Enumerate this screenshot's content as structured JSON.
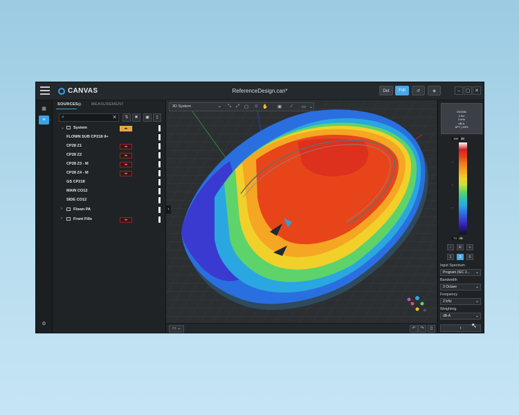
{
  "app": {
    "logo_text": "CANVAS",
    "document_title": "ReferenceDesign.can*",
    "buttons": {
      "det": "Det",
      "full": "Full"
    }
  },
  "sources_panel": {
    "tab_sources": "SOURCES",
    "tab_measurement": "MEASUREMENT",
    "search_placeholder": "",
    "tree": [
      {
        "label": "System",
        "expandable": true,
        "expanded": true
      },
      {
        "label": "FLOWN SUB CP218 II+"
      },
      {
        "label": "CP28 Z1"
      },
      {
        "label": "CP28 Z2"
      },
      {
        "label": "CP28 Z3 - M"
      },
      {
        "label": "CP28 Z4 - M"
      },
      {
        "label": "GS CP218"
      },
      {
        "label": "MAIN CO12"
      },
      {
        "label": "SIDE CO12"
      },
      {
        "label": "Flown PA",
        "expandable": true,
        "expanded": false
      },
      {
        "label": "Front Fills",
        "expandable": true,
        "expanded": false
      }
    ]
  },
  "viewport": {
    "view_mode": "3D System"
  },
  "right_panel": {
    "legend": [
      "ISO266",
      "2.0m",
      "2 kHz",
      "dB-A",
      "SPT | 63%"
    ],
    "scale_max": "104",
    "scale_min": "74",
    "scale_unit": "dB",
    "scale_colors": [
      "#ffffff",
      "#d42020",
      "#e8441a",
      "#f07a1e",
      "#f5a623",
      "#f2d02a",
      "#c8e23a",
      "#5ed36a",
      "#2ec2b0",
      "#2aa6e0",
      "#2a6fe0",
      "#3a3ad0",
      "#2a1a9a",
      "#141414"
    ],
    "zoom_minus": "-",
    "zoom_reset": "R",
    "zoom_plus": "+",
    "resolution_options": [
      "1",
      "3",
      "6"
    ],
    "resolution_selected": "3",
    "input_spectrum_label": "Input Spectrum",
    "input_spectrum_value": "Program (IEC 2...",
    "bandwidth_label": "Bandwidth",
    "bandwidth_value": "3 Octave",
    "frequency_label": "Frequency",
    "frequency_value": "2 kHz",
    "weighting_label": "Weighting",
    "weighting_value": "dB-A"
  }
}
